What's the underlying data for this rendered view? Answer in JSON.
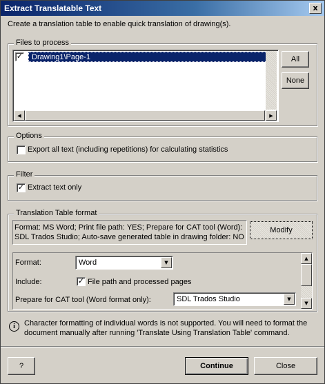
{
  "window": {
    "title": "Extract Translatable Text",
    "close_glyph": "x"
  },
  "intro_text": "Create a translation table to enable quick translation of drawing(s).",
  "files": {
    "legend": "Files to process",
    "items": [
      {
        "label": "Drawing1\\Page-1",
        "checked": true,
        "check_glyph": "✓"
      }
    ],
    "all_label": "All",
    "none_label": "None"
  },
  "options": {
    "legend": "Options",
    "export_all_label": "Export all text (including repetitions) for calculating statistics",
    "export_all_checked": false
  },
  "filter": {
    "legend": "Filter",
    "extract_text_only_label": "Extract text only",
    "extract_text_only_checked": true,
    "check_glyph": "✓"
  },
  "table_format": {
    "legend": "Translation Table format",
    "summary_line1": "Format: MS Word; Print file path: YES; Prepare for CAT tool (Word):",
    "summary_line2": "SDL Trados Studio; Auto-save generated table in drawing folder: NO",
    "modify_label": "Modify",
    "format_label": "Format:",
    "format_value": "Word",
    "include_label": "Include:",
    "include_file_path_label": "File path and processed pages",
    "include_file_path_checked": true,
    "check_glyph": "✓",
    "cat_tool_label": "Prepare for CAT tool (Word format only):",
    "cat_tool_value": "SDL Trados Studio"
  },
  "info": {
    "icon": "info-icon",
    "glyph": "i",
    "line1": "Character formatting of individual words is not supported. You will need to format the",
    "line2": "document manually after running 'Translate Using Translation Table' command."
  },
  "footer": {
    "help_label": "?",
    "continue_label": "Continue",
    "close_label": "Close"
  },
  "glyphs": {
    "up": "▲",
    "down": "▼",
    "left": "◀",
    "right": "▶"
  }
}
